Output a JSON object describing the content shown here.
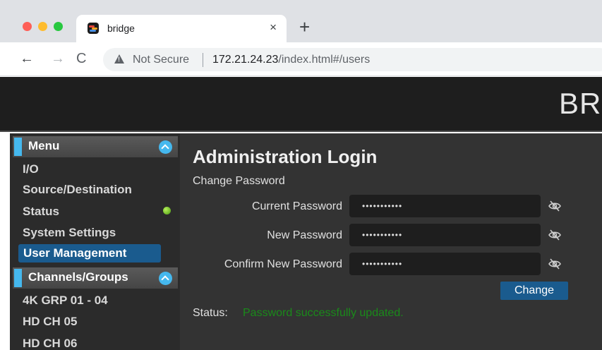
{
  "browser": {
    "tab_title": "bridge",
    "tab_close": "×",
    "new_tab": "+",
    "back": "←",
    "forward": "→",
    "reload": "C",
    "security_text": "Not Secure",
    "url_host": "172.21.24.23",
    "url_path": "/index.html#/users"
  },
  "header": {
    "brand": "BR"
  },
  "sidebar": {
    "menu_title": "Menu",
    "items": [
      "I/O",
      "Source/Destination",
      "Status",
      "System Settings",
      "User Management"
    ],
    "channels_title": "Channels/Groups",
    "channels": [
      "4K GRP 01 - 04",
      "HD CH 05",
      "HD CH 06"
    ]
  },
  "main": {
    "title": "Administration Login",
    "subtitle": "Change Password",
    "fields": [
      {
        "label": "Current Password",
        "value": "•••••••••••"
      },
      {
        "label": "New Password",
        "value": "•••••••••••"
      },
      {
        "label": "Confirm New Password",
        "value": "•••••••••••"
      }
    ],
    "change_button": "Change",
    "status_label": "Status:",
    "status_message": "Password successfully updated."
  },
  "colors": {
    "accent": "#45b8ee",
    "active_item": "#1a5b8e",
    "status_success": "#1a8a1a",
    "status_dot": "#7ed321"
  },
  "icons": [
    "warning-icon",
    "eye-slash-icon",
    "chevron-up-icon",
    "bridge-favicon"
  ]
}
